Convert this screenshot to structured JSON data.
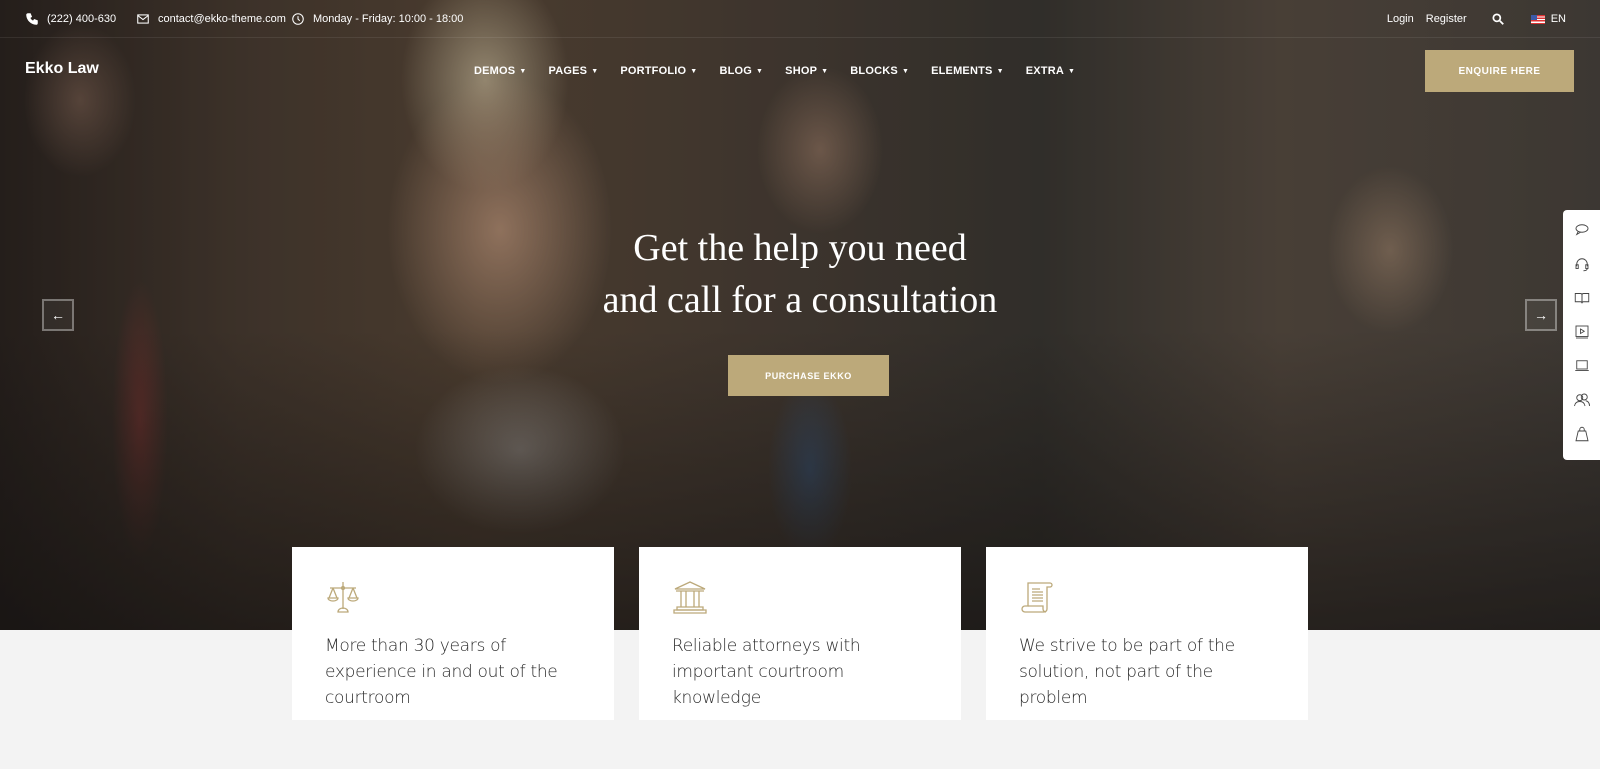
{
  "topbar": {
    "phone": "(222) 400-630",
    "email": "contact@ekko-theme.com",
    "hours": "Monday - Friday: 10:00 - 18:00",
    "login": "Login",
    "register": "Register",
    "language": "EN"
  },
  "header": {
    "logo": "Ekko Law",
    "nav": [
      "DEMOS",
      "PAGES",
      "PORTFOLIO",
      "BLOG",
      "SHOP",
      "BLOCKS",
      "ELEMENTS",
      "EXTRA"
    ],
    "cta": "ENQUIRE HERE"
  },
  "hero": {
    "line1": "Get the help you need",
    "line2": "and call for a consultation",
    "button": "PURCHASE EKKO",
    "prev": "←",
    "next": "→"
  },
  "side_panel": {
    "icons": [
      "chat-icon",
      "headset-icon",
      "book-icon",
      "video-icon",
      "laptop-icon",
      "users-icon",
      "shopping-bag-icon"
    ]
  },
  "features": [
    {
      "icon": "scales-icon",
      "text": "More than 30 years of experience in and out of the courtroom"
    },
    {
      "icon": "courthouse-icon",
      "text": "Reliable attorneys with important courtroom knowledge"
    },
    {
      "icon": "scroll-icon",
      "text": "We strive to be part of the solution, not part of the problem"
    }
  ],
  "colors": {
    "accent": "#bca97a",
    "background": "#f3f3f3",
    "card": "#ffffff"
  }
}
